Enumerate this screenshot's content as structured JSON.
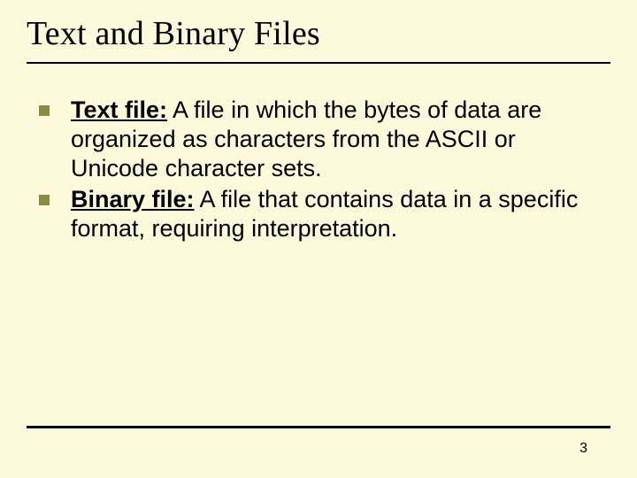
{
  "title": "Text and Binary Files",
  "bullets": [
    {
      "term": "Text file:",
      "def": "   A file in which the bytes of data are organized as characters from the ASCII or Unicode character sets."
    },
    {
      "term": "Binary file:",
      "def": "  A file that contains data in a specific format, requiring interpretation."
    }
  ],
  "page_number": "3"
}
